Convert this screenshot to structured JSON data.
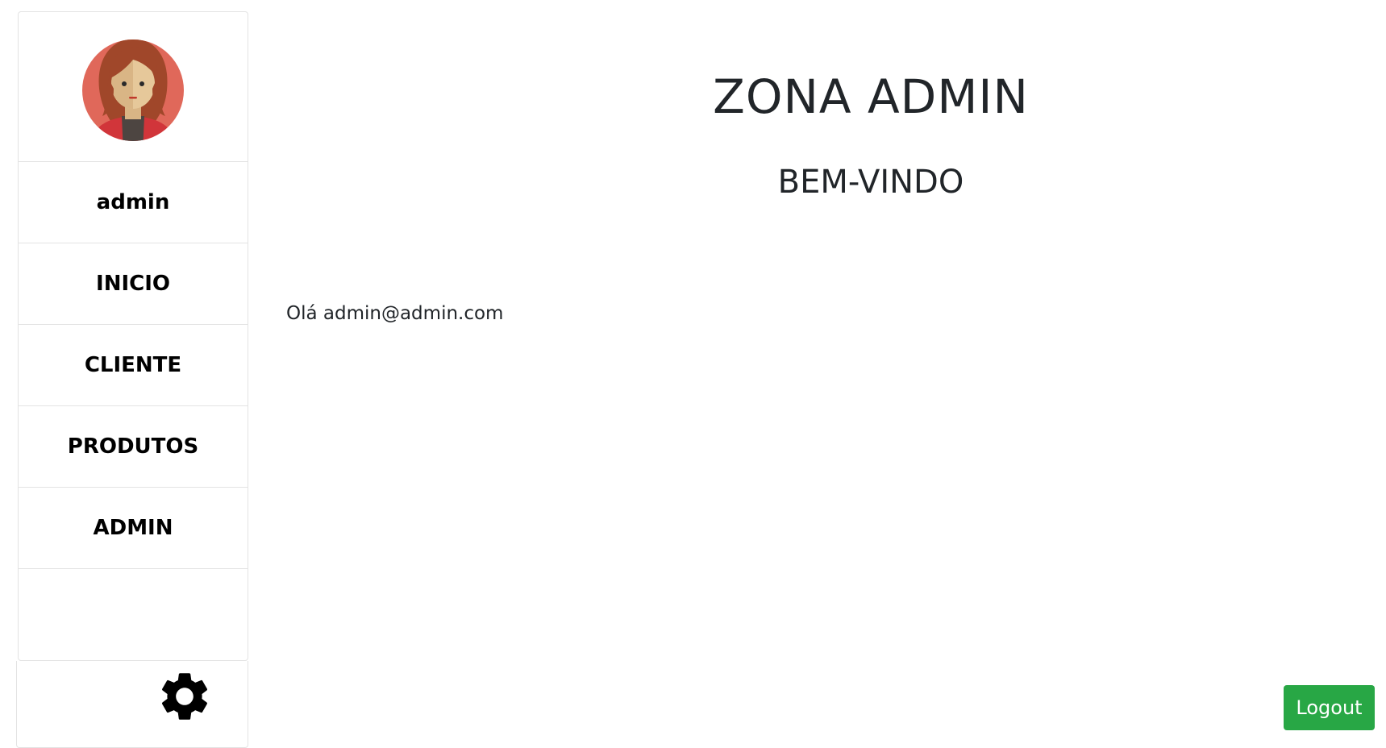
{
  "sidebar": {
    "username": "admin",
    "items": [
      {
        "label": "INICIO"
      },
      {
        "label": "CLIENTE"
      },
      {
        "label": "PRODUTOS"
      },
      {
        "label": "ADMIN"
      }
    ],
    "avatar_icon": "woman-avatar-icon",
    "settings_icon": "gear-icon"
  },
  "main": {
    "title": "ZONA ADMIN",
    "subtitle": "BEM-VINDO",
    "greeting": "Olá admin@admin.com"
  },
  "logout_button": {
    "label": "Logout",
    "color": "#28a745"
  },
  "colors": {
    "avatar_bg": "#e0685a",
    "hair": "#a0472a",
    "skin": "#e6c89a",
    "jacket": "#d1353a"
  }
}
